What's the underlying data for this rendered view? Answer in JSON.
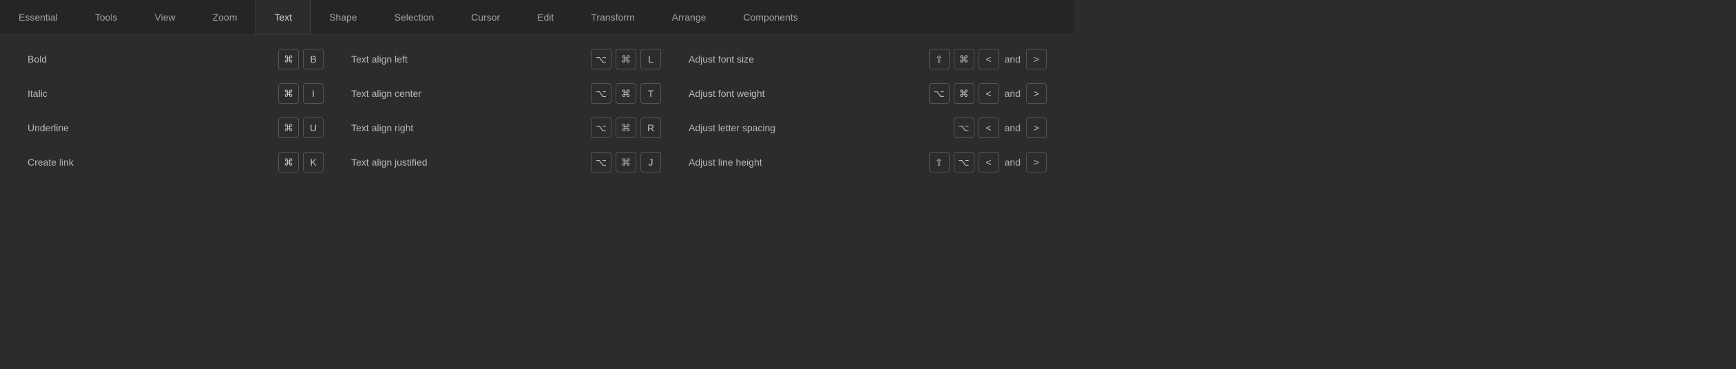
{
  "tabs": {
    "items": [
      {
        "label": "Essential"
      },
      {
        "label": "Tools"
      },
      {
        "label": "View"
      },
      {
        "label": "Zoom"
      },
      {
        "label": "Text"
      },
      {
        "label": "Shape"
      },
      {
        "label": "Selection"
      },
      {
        "label": "Cursor"
      },
      {
        "label": "Edit"
      },
      {
        "label": "Transform"
      },
      {
        "label": "Arrange"
      },
      {
        "label": "Components"
      }
    ],
    "active_index": 4
  },
  "separator": "and",
  "shortcuts": {
    "col1": [
      {
        "label": "Bold",
        "keys": [
          "⌘",
          "B"
        ]
      },
      {
        "label": "Italic",
        "keys": [
          "⌘",
          "I"
        ]
      },
      {
        "label": "Underline",
        "keys": [
          "⌘",
          "U"
        ]
      },
      {
        "label": "Create link",
        "keys": [
          "⌘",
          "K"
        ]
      }
    ],
    "col2": [
      {
        "label": "Text align left",
        "keys": [
          "⌥",
          "⌘",
          "L"
        ]
      },
      {
        "label": "Text align center",
        "keys": [
          "⌥",
          "⌘",
          "T"
        ]
      },
      {
        "label": "Text align right",
        "keys": [
          "⌥",
          "⌘",
          "R"
        ]
      },
      {
        "label": "Text align justified",
        "keys": [
          "⌥",
          "⌘",
          "J"
        ]
      }
    ],
    "col3": [
      {
        "label": "Adjust font size",
        "keys_a": [
          "⇧",
          "⌘",
          "<"
        ],
        "keys_b": [
          ">"
        ]
      },
      {
        "label": "Adjust font weight",
        "keys_a": [
          "⌥",
          "⌘",
          "<"
        ],
        "keys_b": [
          ">"
        ]
      },
      {
        "label": "Adjust letter spacing",
        "keys_a": [
          "⌥",
          "<"
        ],
        "keys_b": [
          ">"
        ]
      },
      {
        "label": "Adjust line height",
        "keys_a": [
          "⇧",
          "⌥",
          "<"
        ],
        "keys_b": [
          ">"
        ]
      }
    ]
  }
}
